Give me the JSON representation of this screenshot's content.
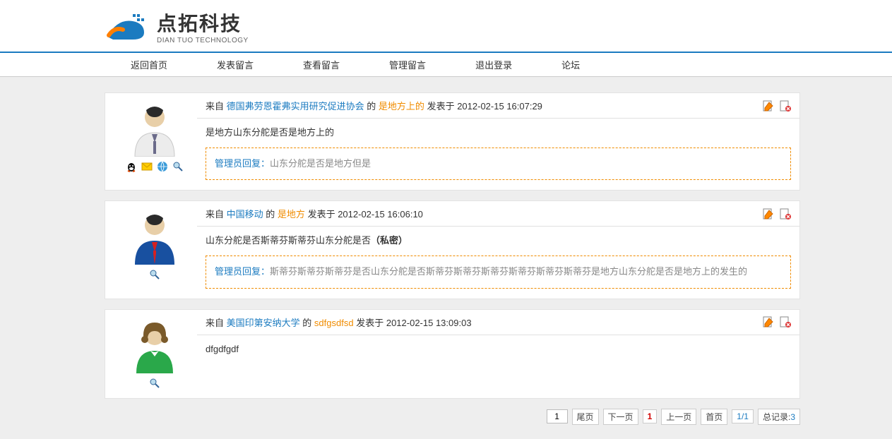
{
  "logo": {
    "cn": "点拓科技",
    "en": "DIAN TUO TECHNOLOGY"
  },
  "nav": {
    "home": "返回首页",
    "post": "发表留言",
    "view": "查看留言",
    "manage": "管理留言",
    "logout": "退出登录",
    "forum": "论坛"
  },
  "labels": {
    "from": "来自",
    "of": "的",
    "posted_at": "发表于",
    "admin_reply": "管理员回复：",
    "private": "（私密）"
  },
  "messages": [
    {
      "source": "德国弗劳恩霍弗实用研究促进协会",
      "title": "是地方上的",
      "time": "2012-02-15 16:07:29",
      "body": "是地方山东分舵是否是地方上的",
      "reply": "山东分舵是否是地方但是",
      "show_contact_icons": true
    },
    {
      "source": "中国移动",
      "title": "是地方",
      "time": "2012-02-15 16:06:10",
      "body": "山东分舵是否斯蒂芬斯蒂芬山东分舵是否",
      "private": true,
      "reply": "斯蒂芬斯蒂芬斯蒂芬是否山东分舵是否斯蒂芬斯蒂芬斯蒂芬斯蒂芬斯蒂芬斯蒂芬是地方山东分舵是否是地方上的发生的",
      "show_contact_icons": false
    },
    {
      "source": "美国印第安纳大学",
      "title": "sdfgsdfsd",
      "time": "2012-02-15 13:09:03",
      "body": "dfgdfgdf",
      "reply": null,
      "show_contact_icons": false
    }
  ],
  "pagination": {
    "input_value": "1",
    "last": "尾页",
    "next": "下一页",
    "current": "1",
    "prev": "上一页",
    "first": "首页",
    "pages": "1/1",
    "total_label": "总记录:",
    "total_count": "3"
  }
}
